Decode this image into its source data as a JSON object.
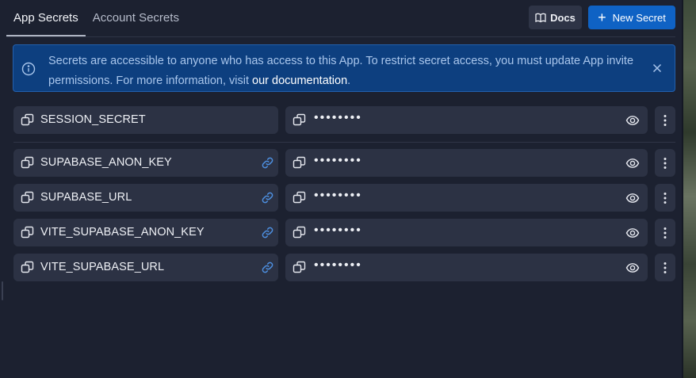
{
  "tabs": [
    {
      "label": "App Secrets",
      "active": true
    },
    {
      "label": "Account Secrets",
      "active": false
    }
  ],
  "header": {
    "docs_label": "Docs",
    "docs_icon": "book-icon",
    "new_secret_label": "New Secret",
    "new_secret_icon": "plus-icon"
  },
  "banner": {
    "text": "Secrets are accessible to anyone who has access to this App. To restrict secret access, you must update App invite permissions. For more information, visit ",
    "link_text": "our documentation",
    "trailing": ".",
    "icon": "info-icon",
    "close_icon": "close-icon"
  },
  "secrets": [
    {
      "name": "SESSION_SECRET",
      "value": "••••••••",
      "linked": false
    },
    {
      "name": "SUPABASE_ANON_KEY",
      "value": "••••••••",
      "linked": true
    },
    {
      "name": "SUPABASE_URL",
      "value": "••••••••",
      "linked": true
    },
    {
      "name": "VITE_SUPABASE_ANON_KEY",
      "value": "••••••••",
      "linked": true
    },
    {
      "name": "VITE_SUPABASE_URL",
      "value": "••••••••",
      "linked": true
    }
  ],
  "colors": {
    "background": "#1c2130",
    "row": "#2c3244",
    "accent": "#0f62c4",
    "banner": "#0d3f7f",
    "link_icon": "#4d8fe0"
  }
}
